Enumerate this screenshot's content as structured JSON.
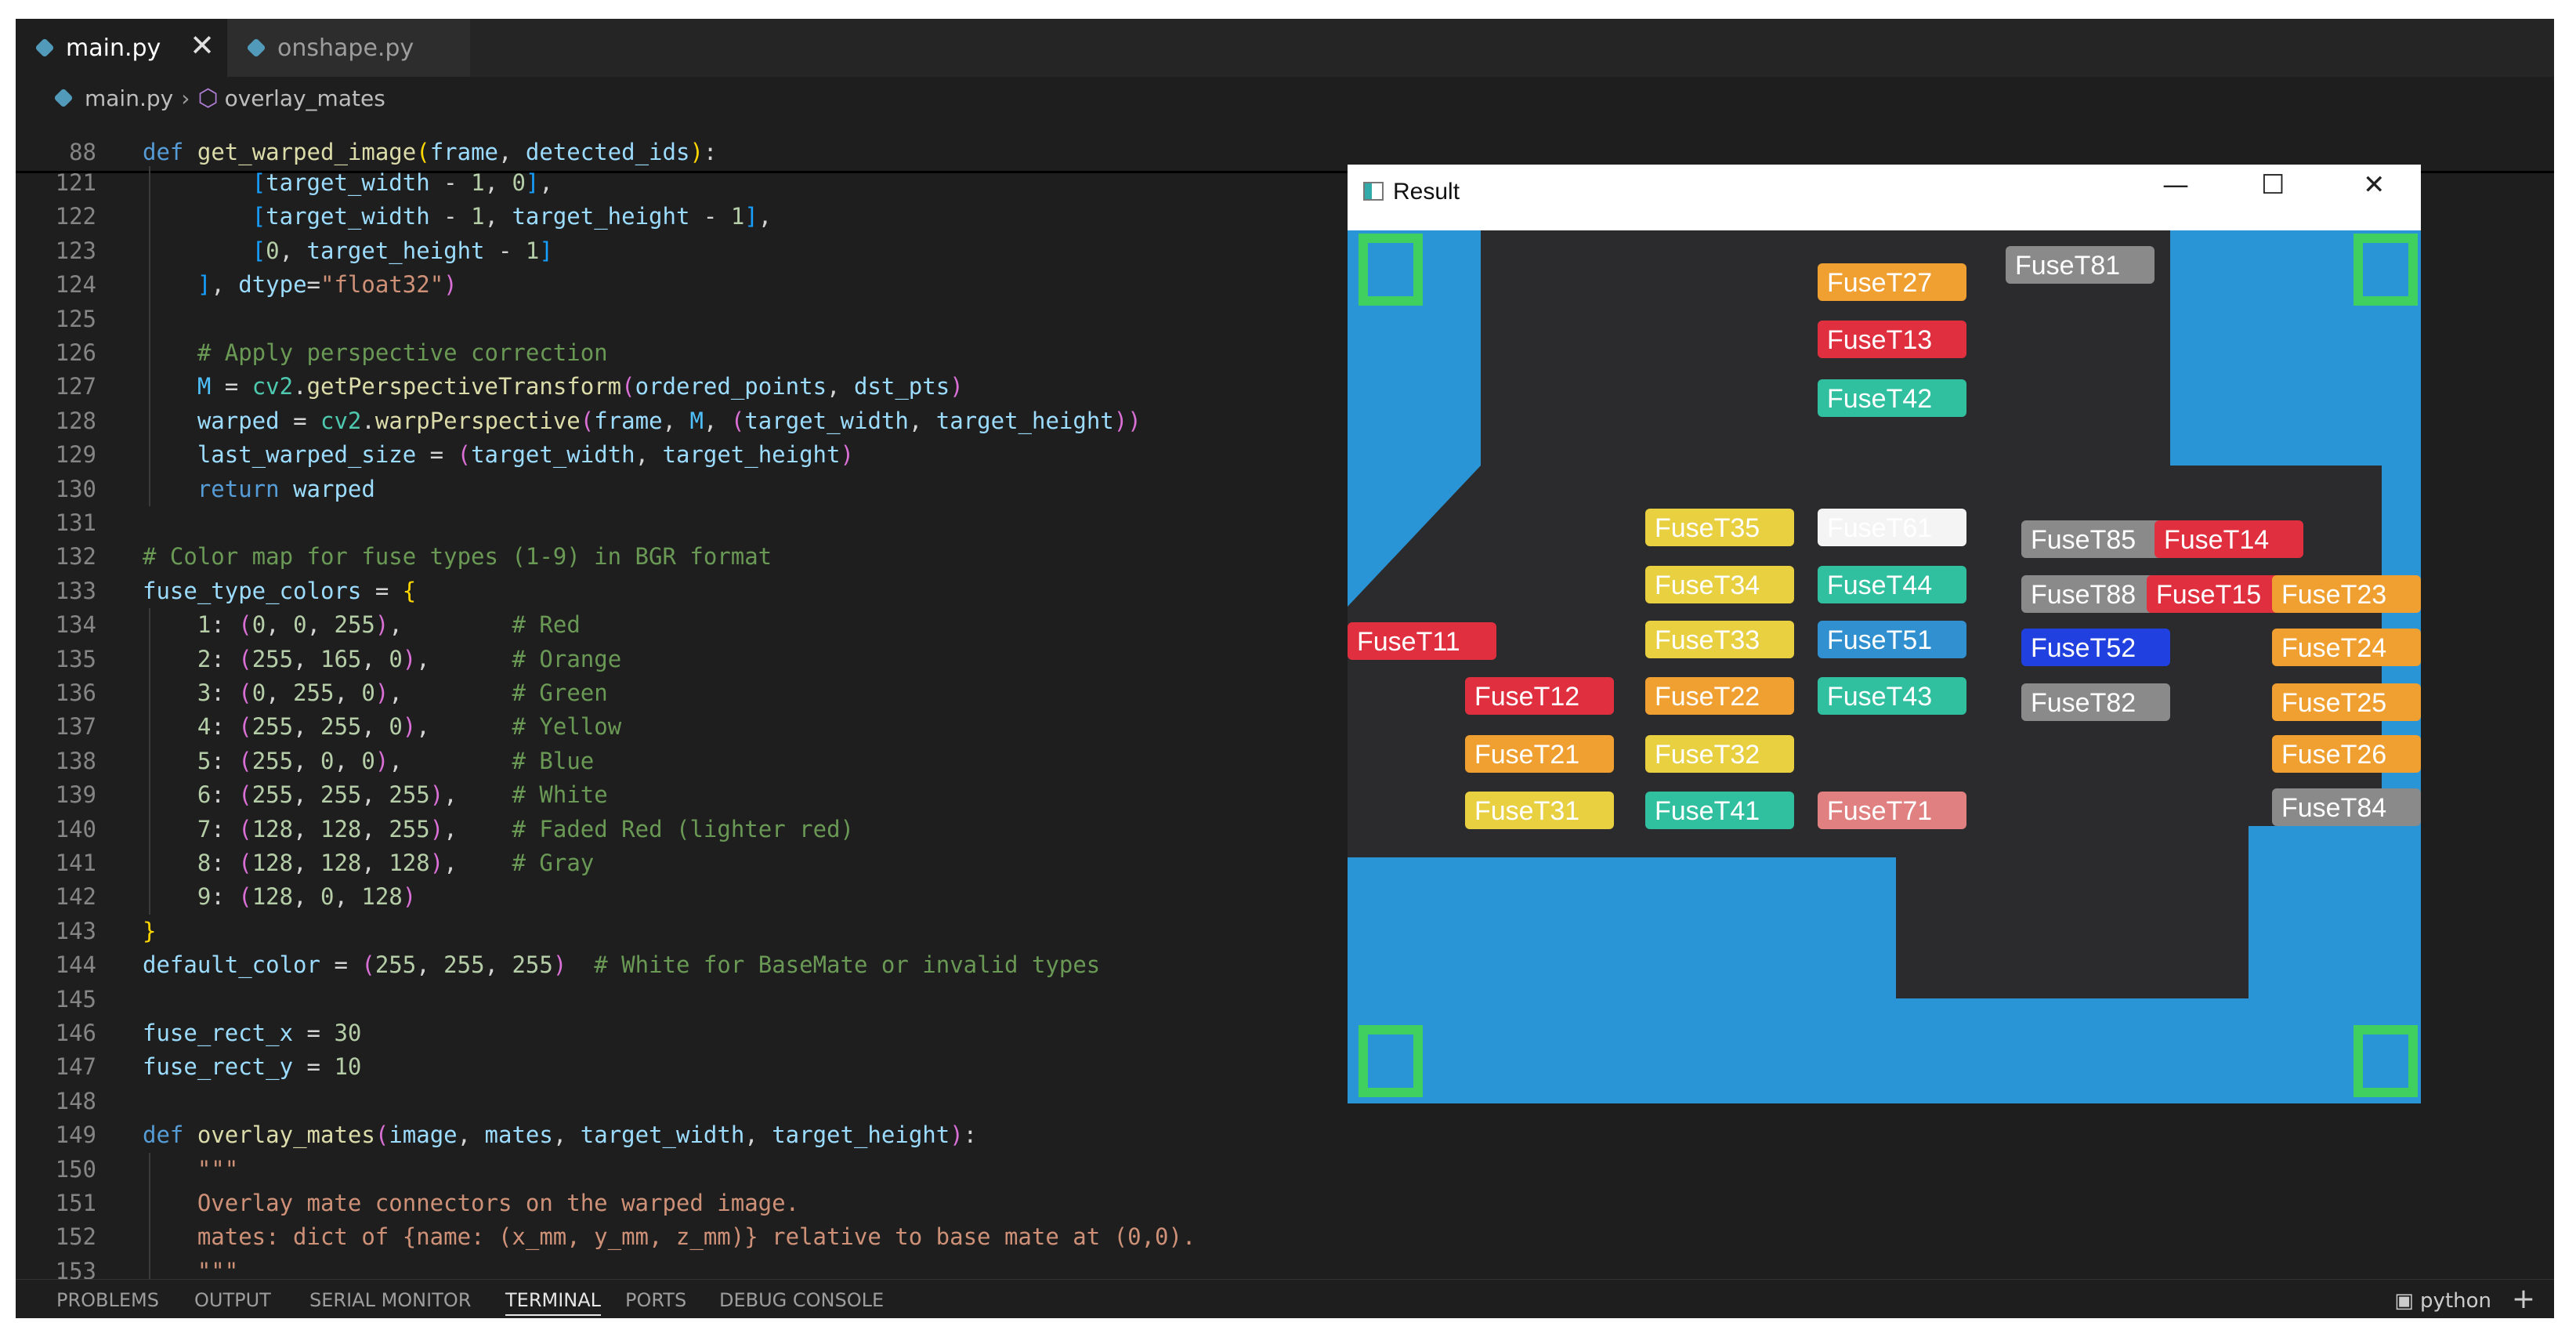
{
  "tabs": [
    {
      "label": "main.py",
      "active": true
    },
    {
      "label": "onshape.py",
      "active": false
    }
  ],
  "breadcrumb": {
    "file": "main.py",
    "symbol": "overlay_mates"
  },
  "sticky": {
    "number": "88",
    "code": "def get_warped_image(frame, detected_ids):"
  },
  "code_lines": [
    {
      "n": "121",
      "text": "        [target_width - 1, 0],"
    },
    {
      "n": "122",
      "text": "        [target_width - 1, target_height - 1],"
    },
    {
      "n": "123",
      "text": "        [0, target_height - 1]"
    },
    {
      "n": "124",
      "text": "    ], dtype=\"float32\")"
    },
    {
      "n": "125",
      "text": ""
    },
    {
      "n": "126",
      "text": "    # Apply perspective correction"
    },
    {
      "n": "127",
      "text": "    M = cv2.getPerspectiveTransform(ordered_points, dst_pts)"
    },
    {
      "n": "128",
      "text": "    warped = cv2.warpPerspective(frame, M, (target_width, target_height))"
    },
    {
      "n": "129",
      "text": "    last_warped_size = (target_width, target_height)"
    },
    {
      "n": "130",
      "text": "    return warped"
    },
    {
      "n": "131",
      "text": ""
    },
    {
      "n": "132",
      "text": "# Color map for fuse types (1-9) in BGR format"
    },
    {
      "n": "133",
      "text": "fuse_type_colors = {"
    },
    {
      "n": "134",
      "text": "    1: (0, 0, 255),        # Red"
    },
    {
      "n": "135",
      "text": "    2: (255, 165, 0),      # Orange"
    },
    {
      "n": "136",
      "text": "    3: (0, 255, 0),        # Green"
    },
    {
      "n": "137",
      "text": "    4: (255, 255, 0),      # Yellow"
    },
    {
      "n": "138",
      "text": "    5: (255, 0, 0),        # Blue"
    },
    {
      "n": "139",
      "text": "    6: (255, 255, 255),    # White"
    },
    {
      "n": "140",
      "text": "    7: (128, 128, 255),    # Faded Red (lighter red)"
    },
    {
      "n": "141",
      "text": "    8: (128, 128, 128),    # Gray"
    },
    {
      "n": "142",
      "text": "    9: (128, 0, 128)"
    },
    {
      "n": "143",
      "text": "}"
    },
    {
      "n": "144",
      "text": "default_color = (255, 255, 255)  # White for BaseMate or invalid types"
    },
    {
      "n": "145",
      "text": ""
    },
    {
      "n": "146",
      "text": "fuse_rect_x = 30"
    },
    {
      "n": "147",
      "text": "fuse_rect_y = 10"
    },
    {
      "n": "148",
      "text": ""
    },
    {
      "n": "149",
      "text": "def overlay_mates(image, mates, target_width, target_height):"
    },
    {
      "n": "150",
      "text": "    \"\"\""
    },
    {
      "n": "151",
      "text": "    Overlay mate connectors on the warped image."
    },
    {
      "n": "152",
      "text": "    mates: dict of {name: (x_mm, y_mm, z_mm)} relative to base mate at (0,0)."
    },
    {
      "n": "153",
      "text": "    \"\"\""
    }
  ],
  "panel_tabs": [
    {
      "label": "PROBLEMS",
      "active": false
    },
    {
      "label": "OUTPUT",
      "active": false
    },
    {
      "label": "SERIAL MONITOR",
      "active": false
    },
    {
      "label": "TERMINAL",
      "active": true
    },
    {
      "label": "PORTS",
      "active": false
    },
    {
      "label": "DEBUG CONSOLE",
      "active": false
    }
  ],
  "terminal": {
    "shell": "python",
    "new": "+"
  },
  "result_window": {
    "title": "Result",
    "buttons": {
      "minimize": "—",
      "maximize": "☐",
      "close": "✕"
    },
    "fuses": [
      {
        "label": "FuseT27",
        "color": "#f0a030"
      },
      {
        "label": "FuseT81",
        "color": "#8a8a8a"
      },
      {
        "label": "FuseT13",
        "color": "#e03040"
      },
      {
        "label": "FuseT42",
        "color": "#30c0a0"
      },
      {
        "label": "FuseT35",
        "color": "#e8d040"
      },
      {
        "label": "FuseT61",
        "color": "#f4f4f4"
      },
      {
        "label": "FuseT85",
        "color": "#8a8a8a"
      },
      {
        "label": "FuseT14",
        "color": "#e03040"
      },
      {
        "label": "FuseT34",
        "color": "#e8d040"
      },
      {
        "label": "FuseT44",
        "color": "#30c0a0"
      },
      {
        "label": "FuseT88",
        "color": "#8a8a8a"
      },
      {
        "label": "FuseT15",
        "color": "#e03040"
      },
      {
        "label": "FuseT23",
        "color": "#f0a030"
      },
      {
        "label": "FuseT11",
        "color": "#e03040"
      },
      {
        "label": "FuseT33",
        "color": "#e8d040"
      },
      {
        "label": "FuseT51",
        "color": "#3090d0"
      },
      {
        "label": "FuseT52",
        "color": "#2040e0"
      },
      {
        "label": "FuseT24",
        "color": "#f0a030"
      },
      {
        "label": "FuseT12",
        "color": "#e03040"
      },
      {
        "label": "FuseT22",
        "color": "#f0a030"
      },
      {
        "label": "FuseT43",
        "color": "#30c0a0"
      },
      {
        "label": "FuseT82",
        "color": "#8a8a8a"
      },
      {
        "label": "FuseT25",
        "color": "#f0a030"
      },
      {
        "label": "FuseT21",
        "color": "#f0a030"
      },
      {
        "label": "FuseT32",
        "color": "#e8d040"
      },
      {
        "label": "FuseT26",
        "color": "#f0a030"
      },
      {
        "label": "FuseT31",
        "color": "#e8d040"
      },
      {
        "label": "FuseT41",
        "color": "#30c0a0"
      },
      {
        "label": "FuseT71",
        "color": "#e08080"
      },
      {
        "label": "FuseT84",
        "color": "#8a8a8a"
      }
    ]
  },
  "colors": {
    "editor_bg": "#1e1e1e",
    "tabbar_bg": "#252526",
    "keyword": "#569cd6",
    "function": "#dcdcaa",
    "variable": "#9cdcfe",
    "string": "#ce9178",
    "number": "#b5cea8",
    "comment": "#6a9955",
    "bracket1": "#ffd700",
    "bracket2": "#da70d6",
    "bracket3": "#179fff",
    "python_icon": "#519aba",
    "symbol_icon": "#b180d7",
    "result_bg": "#2a95d6"
  },
  "icons": [
    "python-file-icon",
    "close-icon",
    "method-cube-icon",
    "chevron-right-icon",
    "terminal-icon",
    "plus-icon",
    "window-icon",
    "minimize-icon",
    "maximize-icon"
  ]
}
